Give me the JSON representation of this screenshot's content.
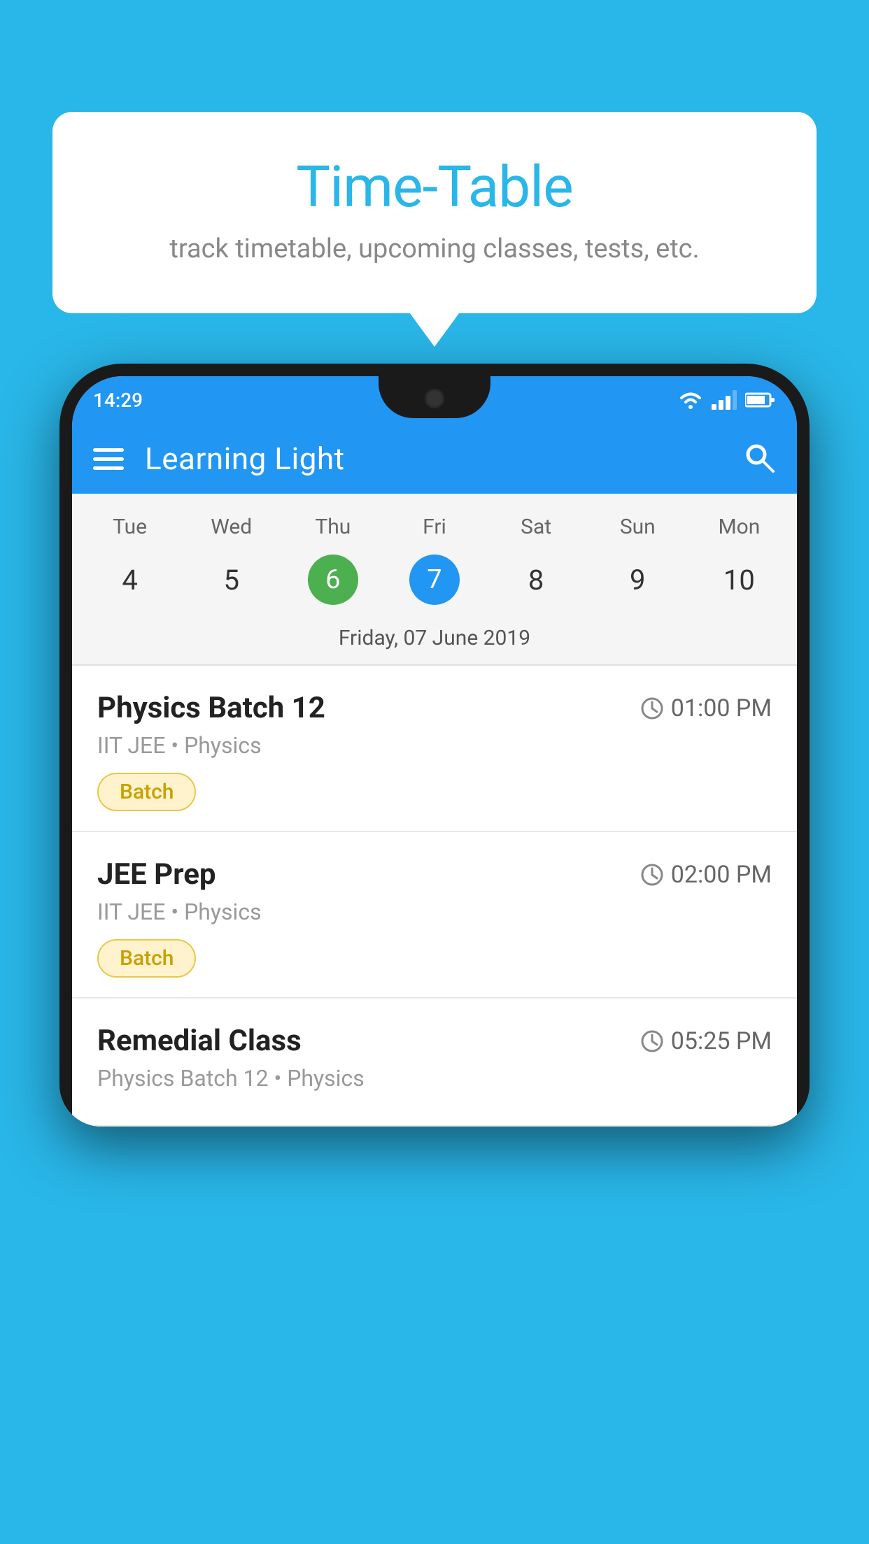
{
  "page": {
    "background_color": "#29b6e8"
  },
  "tooltip": {
    "title": "Time-Table",
    "subtitle": "track timetable, upcoming classes, tests, etc."
  },
  "phone": {
    "status_bar": {
      "time": "14:29"
    },
    "toolbar": {
      "app_name": "Learning Light",
      "menu_icon": "hamburger-icon",
      "search_icon": "search-icon"
    },
    "calendar": {
      "days": [
        {
          "name": "Tue",
          "num": "4",
          "state": "normal"
        },
        {
          "name": "Wed",
          "num": "5",
          "state": "normal"
        },
        {
          "name": "Thu",
          "num": "6",
          "state": "today"
        },
        {
          "name": "Fri",
          "num": "7",
          "state": "selected"
        },
        {
          "name": "Sat",
          "num": "8",
          "state": "normal"
        },
        {
          "name": "Sun",
          "num": "9",
          "state": "normal"
        },
        {
          "name": "Mon",
          "num": "10",
          "state": "normal"
        }
      ],
      "selected_date_label": "Friday, 07 June 2019"
    },
    "schedule": [
      {
        "title": "Physics Batch 12",
        "time": "01:00 PM",
        "sub": "IIT JEE • Physics",
        "badge": "Batch"
      },
      {
        "title": "JEE Prep",
        "time": "02:00 PM",
        "sub": "IIT JEE • Physics",
        "badge": "Batch"
      },
      {
        "title": "Remedial Class",
        "time": "05:25 PM",
        "sub": "Physics Batch 12 • Physics",
        "badge": null
      }
    ]
  }
}
